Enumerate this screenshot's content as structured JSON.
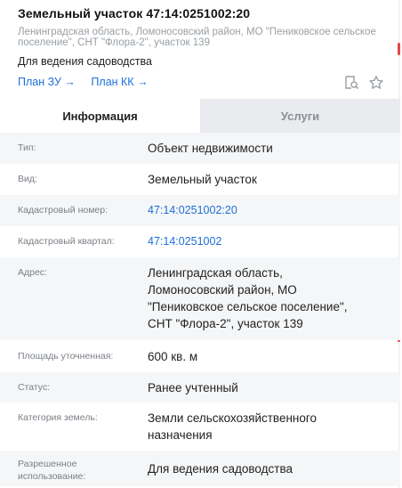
{
  "header": {
    "title": "Земельный участок 47:14:0251002:20",
    "address_line1": "Ленинградская область, Ломоносовский район, МО \"Пениковское сельское",
    "address_line2": "поселение\", СНТ \"Флора-2\", участок 139",
    "purpose": "Для ведения садоводства",
    "links": [
      "План ЗУ →",
      "План КК →"
    ]
  },
  "tabs": [
    "Информация",
    "Услуги"
  ],
  "rows": [
    {
      "label": "Тип:",
      "value": "Объект недвижимости"
    },
    {
      "label": "Вид:",
      "value": "Земельный участок"
    },
    {
      "label": "Кадастровый номер:",
      "value": "47:14:0251002:20"
    },
    {
      "label": "Кадастровый квартал:",
      "value": "47:14:0251002"
    },
    {
      "label": "Адрес:",
      "value_lines": [
        "Ленинградская область,",
        "Ломоносовский район, МО",
        "\"Пениковское сельское поселение\",",
        "СНТ \"Флора-2\", участок 139"
      ]
    },
    {
      "label": "Площадь уточненная:",
      "value": "600 кв. м"
    },
    {
      "label": "Статус:",
      "value": "Ранее учтенный"
    },
    {
      "label": "Категория земель:",
      "value_lines": [
        "Земли сельскохозяйственного",
        "назначения"
      ]
    },
    {
      "label_lines": [
        "Разрешенное",
        "использование:"
      ],
      "value": "Для ведения садоводства"
    }
  ],
  "icons": [
    "search-document-icon",
    "star-icon"
  ],
  "colors": {
    "link": "#1e6fd9",
    "tab_inactive_bg": "#e9ebee",
    "row_shaded": "#f5f6f7"
  }
}
